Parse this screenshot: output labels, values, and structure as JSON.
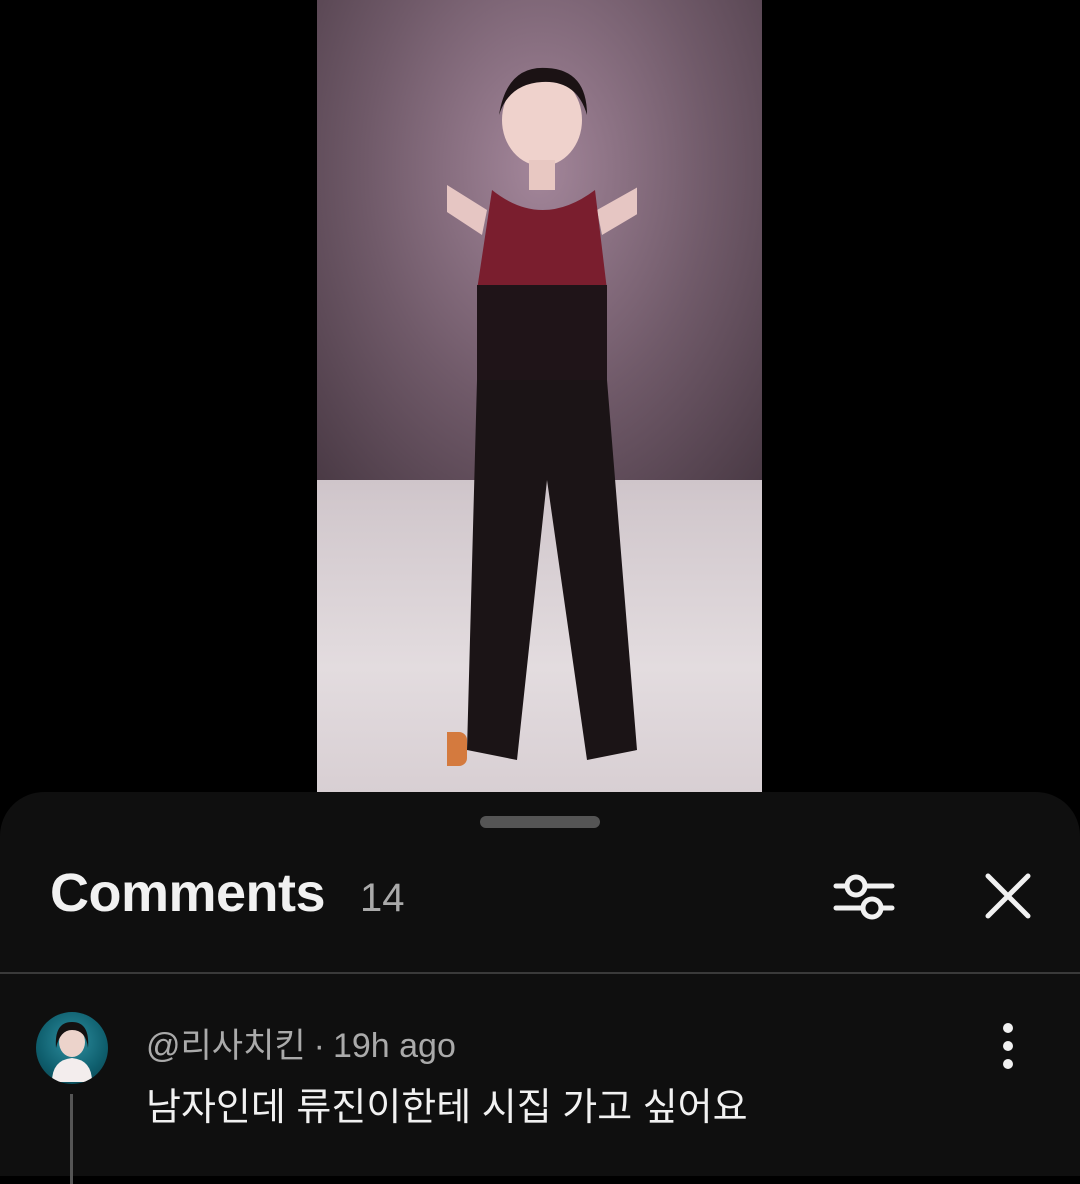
{
  "comments_panel": {
    "title": "Comments",
    "count": "14",
    "filter_icon": "sliders-icon",
    "close_icon": "close-icon"
  },
  "comments": [
    {
      "author": "@리사치킨",
      "separator": "·",
      "time": "19h ago",
      "text": "남자인데 류진이한테 시집 가고 싶어요",
      "menu_icon": "more-vertical-icon"
    }
  ],
  "colors": {
    "sheet_background": "#0f0f0f",
    "primary_text": "#f1f1f1",
    "secondary_text": "#aaaaaa"
  }
}
